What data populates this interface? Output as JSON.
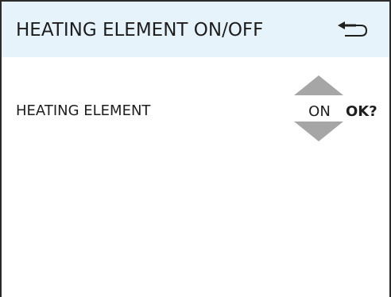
{
  "header": {
    "title": "HEATING ELEMENT ON/OFF",
    "back_icon": "back-arrow-icon"
  },
  "setting": {
    "label": "HEATING ELEMENT",
    "value": "ON",
    "confirm_label": "OK?",
    "increase_icon": "triangle-up-icon",
    "decrease_icon": "triangle-down-icon"
  },
  "colors": {
    "header_bg": "#e6f3fb",
    "arrow": "#a6a6a6",
    "text": "#1e1e1e",
    "frame": "#2b2b2b"
  }
}
